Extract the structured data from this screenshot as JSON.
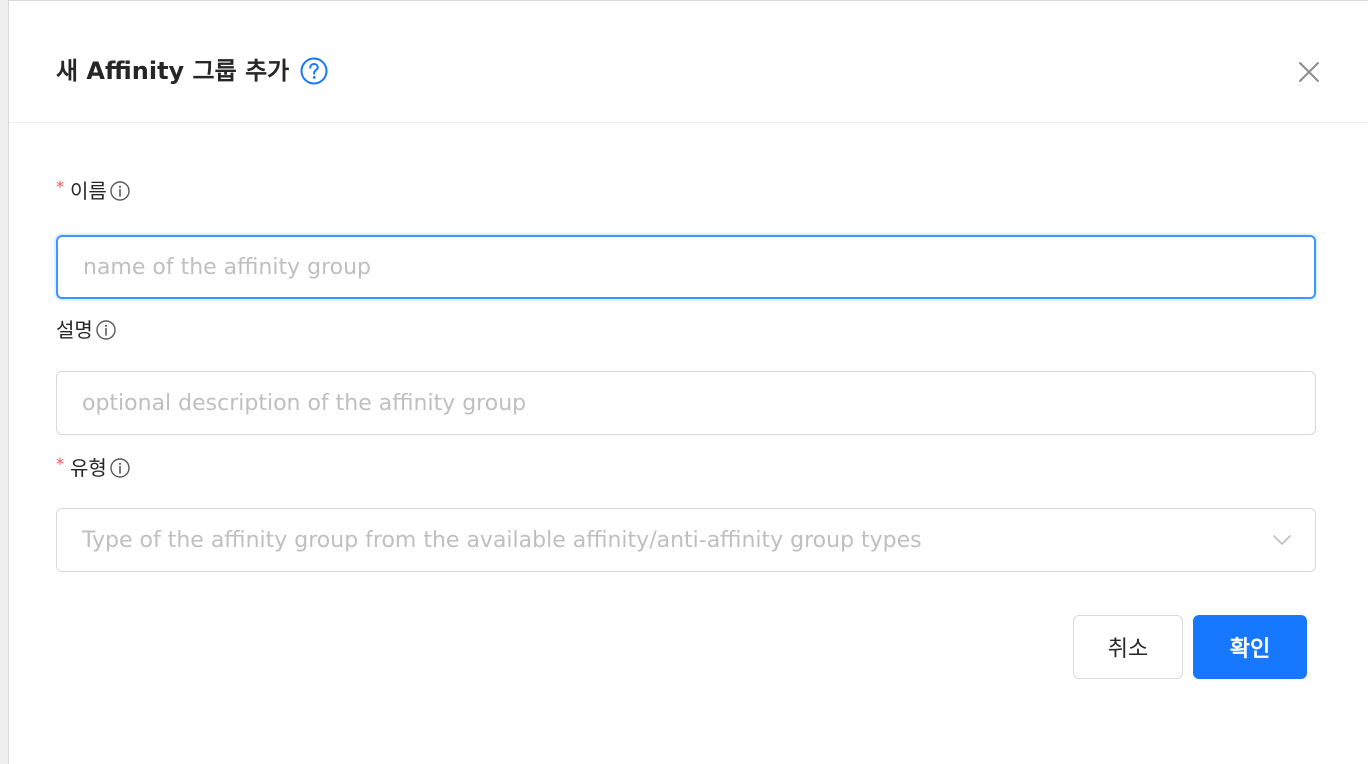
{
  "dialog": {
    "title": "새 Affinity 그룹 추가",
    "help_icon": "question-circle-icon",
    "close_icon": "close-icon"
  },
  "fields": {
    "name": {
      "required_mark": "*",
      "label": "이름",
      "info_icon": "info-circle-icon",
      "placeholder": "name of the affinity group",
      "value": ""
    },
    "description": {
      "label": "설명",
      "info_icon": "info-circle-icon",
      "placeholder": "optional description of the affinity group",
      "value": ""
    },
    "type": {
      "required_mark": "*",
      "label": "유형",
      "info_icon": "info-circle-icon",
      "placeholder": "Type of the affinity group from the available affinity/anti-affinity group types",
      "dropdown_icon": "chevron-down-icon"
    }
  },
  "actions": {
    "cancel_label": "취소",
    "ok_label": "확인"
  },
  "colors": {
    "primary": "#1677ff",
    "required": "#ff4d4f",
    "focus_border": "#4096ff",
    "placeholder": "#bfbfbf"
  }
}
